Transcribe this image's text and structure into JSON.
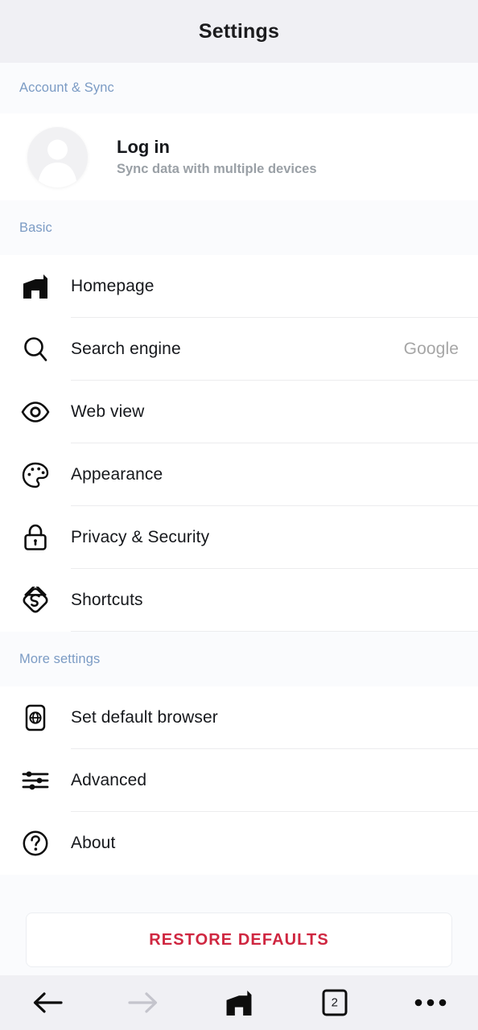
{
  "header": {
    "title": "Settings"
  },
  "sections": [
    {
      "label": "Account & Sync"
    },
    {
      "label": "Basic"
    },
    {
      "label": "More settings"
    }
  ],
  "account": {
    "title": "Log in",
    "subtitle": "Sync data with multiple devices",
    "avatar_icon": "person-avatar-icon"
  },
  "basic_rows": [
    {
      "icon": "maxthon-home-icon",
      "label": "Homepage",
      "value": ""
    },
    {
      "icon": "search-icon",
      "label": "Search engine",
      "value": "Google"
    },
    {
      "icon": "eye-icon",
      "label": "Web view",
      "value": ""
    },
    {
      "icon": "palette-icon",
      "label": "Appearance",
      "value": ""
    },
    {
      "icon": "lock-icon",
      "label": "Privacy & Security",
      "value": ""
    },
    {
      "icon": "shortcuts-icon",
      "label": "Shortcuts",
      "value": ""
    }
  ],
  "more_rows": [
    {
      "icon": "phone-globe-icon",
      "label": "Set default browser",
      "value": ""
    },
    {
      "icon": "sliders-icon",
      "label": "Advanced",
      "value": ""
    },
    {
      "icon": "question-circle-icon",
      "label": "About",
      "value": ""
    }
  ],
  "restore": {
    "label": "RESTORE DEFAULTS"
  },
  "bottom_nav": {
    "back_icon": "arrow-left-icon",
    "forward_icon": "arrow-right-icon",
    "home_icon": "maxthon-home-icon",
    "tabs_icon": "tab-counter-icon",
    "tab_count": "2",
    "menu_icon": "more-horizontal-icon"
  },
  "colors": {
    "header_bg": "#f0f0f4",
    "section_label": "#7b9bc4",
    "restore_text": "#cf2640",
    "row_value": "#a6a6a6",
    "divider": "#ececee"
  }
}
